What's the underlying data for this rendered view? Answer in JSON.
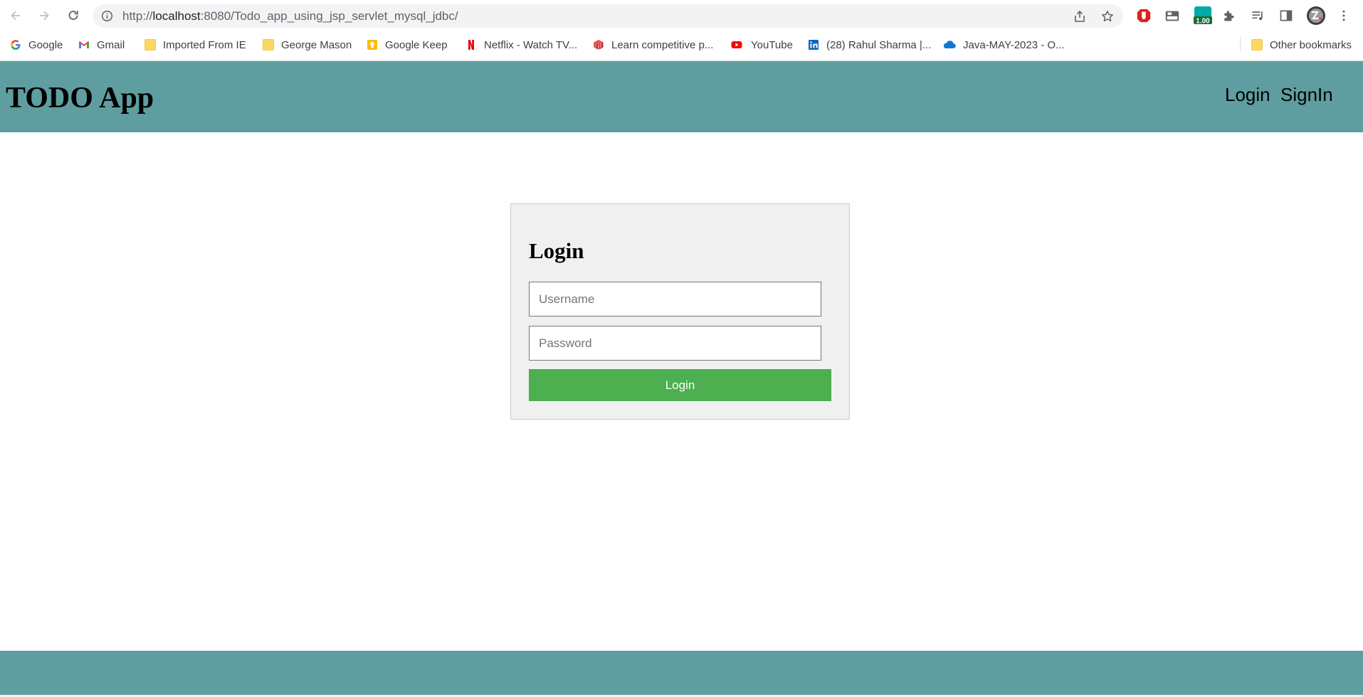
{
  "browser": {
    "url_prefix": "http://",
    "url_host": "localhost",
    "url_rest": ":8080/Todo_app_using_jsp_servlet_mysql_jdbc/",
    "extension_badge": "1.00"
  },
  "bookmarks": [
    {
      "label": "Google",
      "icon": "google-icon"
    },
    {
      "label": "Gmail",
      "icon": "gmail-icon"
    },
    {
      "label": "Imported From IE",
      "icon": "folder-icon"
    },
    {
      "label": "George Mason",
      "icon": "folder-icon"
    },
    {
      "label": "Google Keep",
      "icon": "google-keep-icon"
    },
    {
      "label": "Netflix - Watch TV...",
      "icon": "netflix-icon"
    },
    {
      "label": "Learn competitive p...",
      "icon": "cube-icon"
    },
    {
      "label": "YouTube",
      "icon": "youtube-icon"
    },
    {
      "label": "(28) Rahul Sharma |...",
      "icon": "linkedin-icon"
    },
    {
      "label": "Java-MAY-2023 - O...",
      "icon": "onedrive-icon"
    }
  ],
  "other_bookmarks": "Other bookmarks",
  "header": {
    "title": "TODO App",
    "nav": {
      "login": "Login",
      "signin": "SignIn"
    }
  },
  "login_form": {
    "heading": "Login",
    "username_placeholder": "Username",
    "password_placeholder": "Password",
    "submit_label": "Login"
  },
  "colors": {
    "header_bg": "#5f9ea0",
    "button_bg": "#4caf50",
    "card_bg": "#f0f0f0"
  }
}
